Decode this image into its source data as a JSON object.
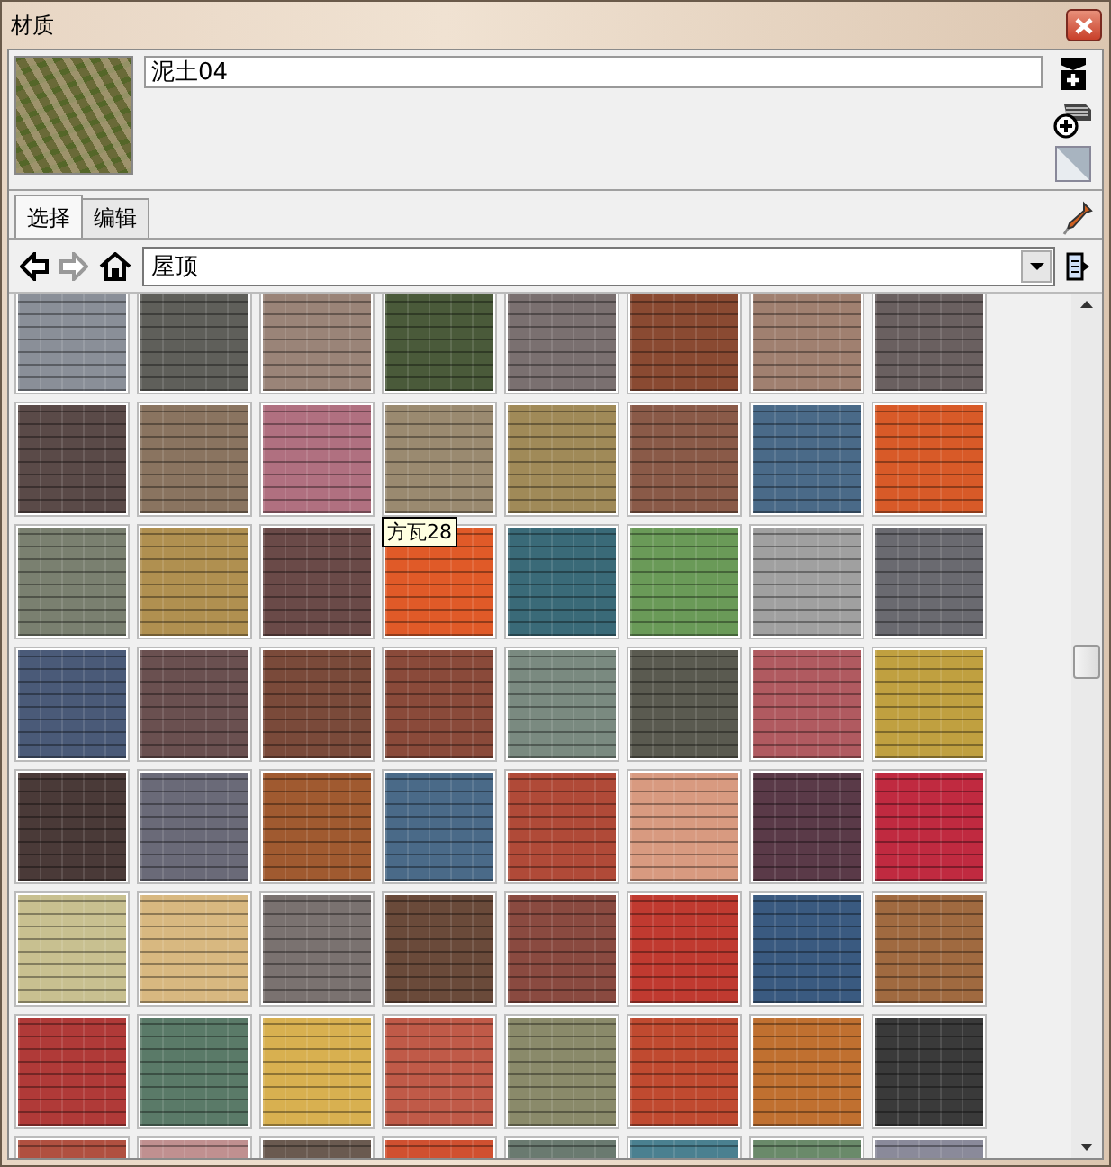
{
  "window": {
    "title": "材质"
  },
  "material": {
    "name": "泥土04"
  },
  "tabs": [
    {
      "label": "选择",
      "selected": true
    },
    {
      "label": "编辑",
      "selected": false
    }
  ],
  "library": {
    "value": "屋顶"
  },
  "swatches": [
    {
      "color": "#8a8f98"
    },
    {
      "color": "#5f5f5a"
    },
    {
      "color": "#9a8478"
    },
    {
      "color": "#4a5a3a"
    },
    {
      "color": "#7a7070"
    },
    {
      "color": "#8a4a32"
    },
    {
      "color": "#a08070"
    },
    {
      "color": "#6a6060"
    },
    {
      "color": "#5a4a48"
    },
    {
      "color": "#8a7460"
    },
    {
      "color": "#b07080"
    },
    {
      "color": "#9a8a70"
    },
    {
      "color": "#a08a58"
    },
    {
      "color": "#8a5a48"
    },
    {
      "color": "#4a6a88"
    },
    {
      "color": "#d85a28"
    },
    {
      "color": "#7a8070"
    },
    {
      "color": "#b09050"
    },
    {
      "color": "#6a4a48"
    },
    {
      "color": "#e05a28",
      "tooltip": "方瓦28"
    },
    {
      "color": "#3a6a78"
    },
    {
      "color": "#6a9a58"
    },
    {
      "color": "#a0a0a0"
    },
    {
      "color": "#6a6a70"
    },
    {
      "color": "#4a5a78"
    },
    {
      "color": "#6a5050"
    },
    {
      "color": "#7a4a3a"
    },
    {
      "color": "#8a4a3a"
    },
    {
      "color": "#7a8a80"
    },
    {
      "color": "#5a5a50"
    },
    {
      "color": "#b05a60"
    },
    {
      "color": "#c0a040"
    },
    {
      "color": "#4a3a38"
    },
    {
      "color": "#6a6a78"
    },
    {
      "color": "#a05a30"
    },
    {
      "color": "#4a6a88"
    },
    {
      "color": "#b04a38"
    },
    {
      "color": "#d89a80"
    },
    {
      "color": "#5a3a48"
    },
    {
      "color": "#c02a40"
    },
    {
      "color": "#c8c090"
    },
    {
      "color": "#d8b880"
    },
    {
      "color": "#7a7270"
    },
    {
      "color": "#6a4a3a"
    },
    {
      "color": "#8a4a40"
    },
    {
      "color": "#c03a30"
    },
    {
      "color": "#3a5a80"
    },
    {
      "color": "#a06a40"
    },
    {
      "color": "#b03a38"
    },
    {
      "color": "#5a7a68"
    },
    {
      "color": "#d8b050"
    },
    {
      "color": "#c05a48"
    },
    {
      "color": "#8a8a6a"
    },
    {
      "color": "#c04a30"
    },
    {
      "color": "#c07030"
    },
    {
      "color": "#3a3a3a"
    },
    {
      "color": "#b05040"
    },
    {
      "color": "#c09090"
    },
    {
      "color": "#6a5a50"
    },
    {
      "color": "#d05030"
    },
    {
      "color": "#6a7a70"
    },
    {
      "color": "#4a8090"
    },
    {
      "color": "#6a8a6a"
    },
    {
      "color": "#8a8a9a"
    }
  ]
}
